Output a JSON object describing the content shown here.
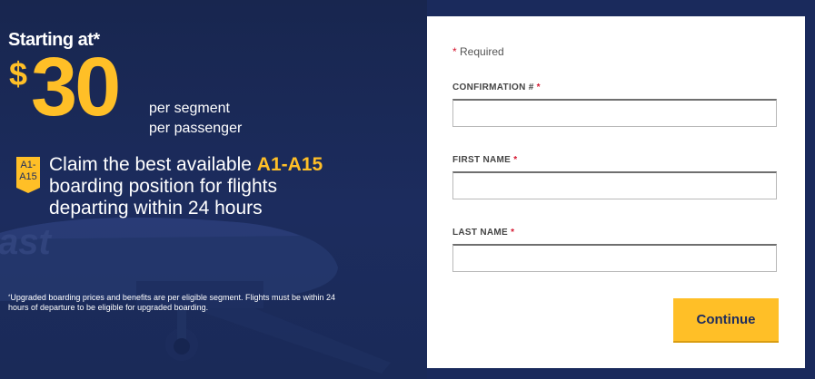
{
  "promo": {
    "starting_label": "Starting at*",
    "currency": "$",
    "price": "30",
    "per_segment": "per segment",
    "per_passenger": "per passenger",
    "badge_line1": "A1-",
    "badge_line2": "A15",
    "claim_before": "Claim the best available ",
    "claim_highlight": "A1-A15",
    "claim_line2": "boarding position for flights",
    "claim_line3": "departing within 24 hours",
    "footnote_mark": "*",
    "footnote": "Upgraded boarding prices and benefits are per eligible segment. Flights must be within 24 hours of departure to be eligible for upgraded boarding."
  },
  "form": {
    "required_star": "*",
    "required_note": " Required",
    "fields": [
      {
        "label": "CONFIRMATION # ",
        "star": "*",
        "value": ""
      },
      {
        "label": "FIRST NAME ",
        "star": "*",
        "value": ""
      },
      {
        "label": "LAST NAME ",
        "star": "*",
        "value": ""
      }
    ],
    "continue_label": "Continue"
  },
  "colors": {
    "navy": "#1c2c5e",
    "yellow": "#ffbf27",
    "required_red": "#d5152e"
  },
  "icons": {
    "badge": "boarding-position-badge-icon",
    "background": "airplane-illustration"
  }
}
